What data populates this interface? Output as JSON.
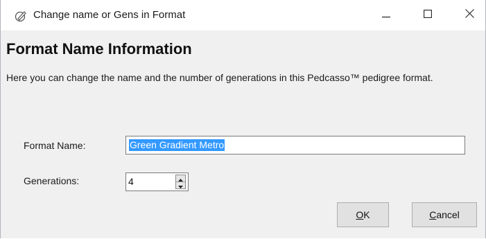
{
  "window": {
    "title": "Change name or Gens in Format",
    "controls": {
      "minimize": "minimize-icon",
      "maximize": "maximize-icon",
      "close": "close-icon"
    }
  },
  "header": {
    "title": "Format Name Information",
    "description": "Here you can change the name and the number of generations in this Pedcasso™ pedigree format."
  },
  "form": {
    "format_name_label": "Format Name:",
    "format_name_value": "Green Gradient Metro",
    "generations_label": "Generations:",
    "generations_value": "4"
  },
  "buttons": {
    "ok_label": "OK",
    "cancel_label": "Cancel"
  },
  "colors": {
    "selection": "#3399ff",
    "button_face": "#e1e1e1",
    "window_bg": "#f0f0f0"
  }
}
